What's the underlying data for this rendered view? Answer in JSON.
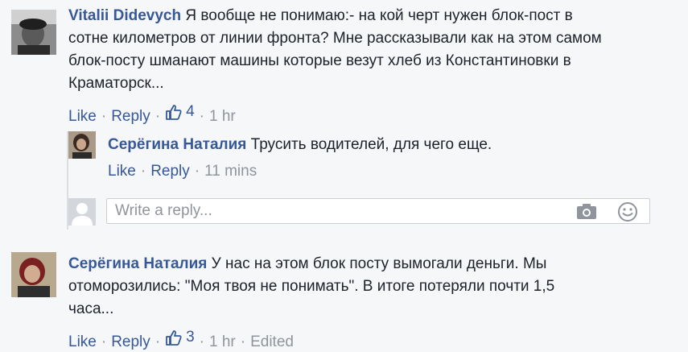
{
  "comments": [
    {
      "author": "Vitalii Didevych",
      "text_lines": [
        "Я вообще не понимаю:- на кой черт нужен блок-пост в",
        "сотне километров от линии фронта? Мне рассказывали как на этом самом",
        "блок-посту шманают машины которые везут хлеб из Константиновки в",
        "Краматорск..."
      ],
      "like_label": "Like",
      "reply_label": "Reply",
      "likes": "4",
      "time": "1 hr"
    },
    {
      "author": "Серёгина Наталия",
      "text_lines": [
        "У нас на этом блок посту вымогали деньги. Мы",
        "отоморозились: \"Моя твоя не понимать\". В итоге потеряли почти 1,5",
        "часа..."
      ],
      "like_label": "Like",
      "reply_label": "Reply",
      "likes": "3",
      "time": "1 hr",
      "edited": "Edited"
    }
  ],
  "reply": {
    "author": "Серёгина Наталия",
    "text": "Трусить водителей, для чего еще.",
    "like_label": "Like",
    "reply_label": "Reply",
    "time": "11 mins"
  },
  "reply_box": {
    "placeholder": "Write a reply...",
    "camera_icon": "camera-icon",
    "emoji_icon": "smiley-icon"
  },
  "colors": {
    "background": "#f6f7f9",
    "link": "#365899",
    "text": "#1d2129",
    "muted": "#90949c"
  }
}
